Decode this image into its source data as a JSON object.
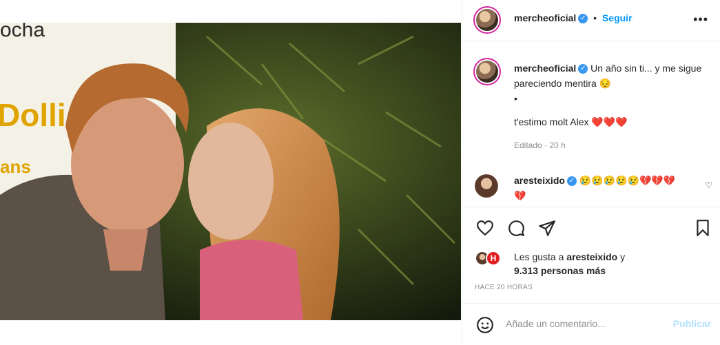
{
  "post": {
    "username": "mercheoficial",
    "follow_label": "Seguir",
    "dot": "•",
    "caption_line1": "Un año sin ti... y me sigue pareciendo mentira 😔",
    "caption_bullet": "•",
    "caption_line2": "t'estimo molt Alex ❤️❤️❤️",
    "edited": "Editado · 20 h"
  },
  "comment": {
    "username": "aresteixido",
    "text": "😢😢😢😢😢💔💔💔💔"
  },
  "likes": {
    "prefix": "Les gusta a",
    "user": "aresteixido",
    "connector": "y",
    "count": "9.313 personas más",
    "time": "HACE 20 HORAS"
  },
  "comment_box": {
    "placeholder": "Añade un comentario...",
    "publish_label": "Publicar"
  },
  "photo": {
    "sign_text_top": "ocha",
    "sign_text_mid": "Dolli",
    "sign_text_bottom": "ans"
  },
  "colors": {
    "accent": "#0095f6",
    "verified": "#3897f0",
    "ring": "#d6249f"
  }
}
